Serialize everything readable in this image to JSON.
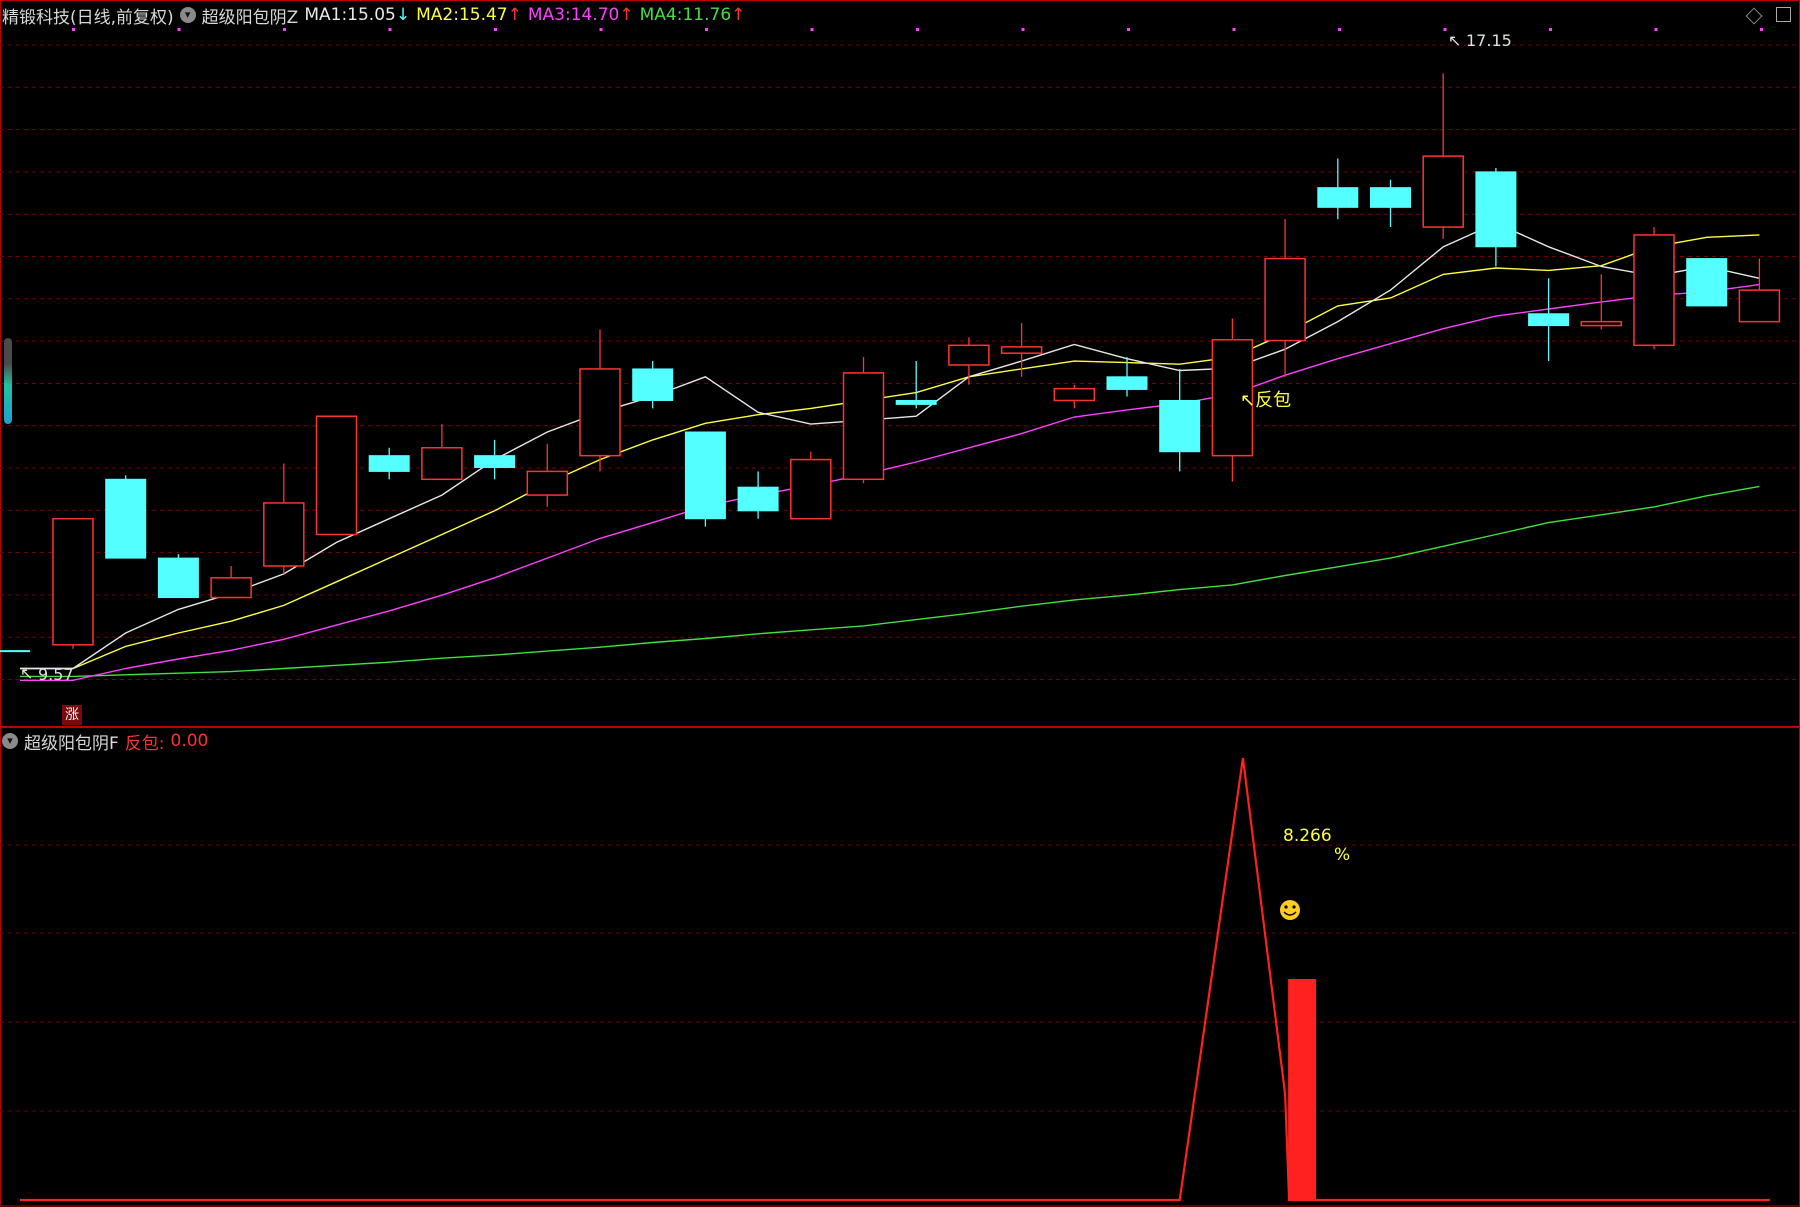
{
  "header": {
    "stock_title": "精锻科技(日线,前复权)",
    "indicator_name": "超级阳包阴Z",
    "ma1_label": "MA1:",
    "ma1_value": "15.05",
    "ma1_arrow": "↓",
    "ma2_label": "MA2:",
    "ma2_value": "15.47",
    "ma2_arrow": "↑",
    "ma3_label": "MA3:",
    "ma3_value": "14.70",
    "ma3_arrow": "↑",
    "ma4_label": "MA4:",
    "ma4_value": "11.76",
    "ma4_arrow": "↑"
  },
  "sub_header": {
    "indicator_name": "超级阳包阴F",
    "param_label": "反包:",
    "param_value": "0.00"
  },
  "annotations": {
    "high_label": "17.15",
    "low_label": "9.57",
    "fanbao_label": "↖反包",
    "zhang_badge": "涨",
    "pct_value": "8.266",
    "pct_sign": "%",
    "smiley": "☺"
  },
  "colors": {
    "background": "#000000",
    "up_candle": "#ff3232",
    "down_candle": "#54ffff",
    "ma1": "#e6e6e6",
    "ma2": "#ffff40",
    "ma3": "#ff40ff",
    "ma4": "#40e040",
    "grid": "#7a0000",
    "panel_border": "#c00000",
    "signal": "#ff2020"
  },
  "chart_data": {
    "type": "candlestick",
    "price_axis": {
      "low": 9.57,
      "high": 17.15
    },
    "candles": [
      {
        "o": 9.9,
        "h": 11.5,
        "l": 9.85,
        "c": 11.5
      },
      {
        "o": 12.0,
        "h": 12.05,
        "l": 11.0,
        "c": 11.0
      },
      {
        "o": 11.0,
        "h": 11.05,
        "l": 10.5,
        "c": 10.5
      },
      {
        "o": 10.5,
        "h": 10.9,
        "l": 10.5,
        "c": 10.75
      },
      {
        "o": 10.9,
        "h": 12.2,
        "l": 10.8,
        "c": 11.7
      },
      {
        "o": 11.3,
        "h": 12.6,
        "l": 11.3,
        "c": 12.8
      },
      {
        "o": 12.3,
        "h": 12.4,
        "l": 12.0,
        "c": 12.1
      },
      {
        "o": 12.0,
        "h": 12.7,
        "l": 12.0,
        "c": 12.4
      },
      {
        "o": 12.3,
        "h": 12.5,
        "l": 12.0,
        "c": 12.15
      },
      {
        "o": 11.8,
        "h": 12.45,
        "l": 11.65,
        "c": 12.1
      },
      {
        "o": 12.3,
        "h": 13.9,
        "l": 12.1,
        "c": 13.4
      },
      {
        "o": 13.4,
        "h": 13.5,
        "l": 12.9,
        "c": 13.0
      },
      {
        "o": 12.6,
        "h": 12.6,
        "l": 11.4,
        "c": 11.5
      },
      {
        "o": 11.9,
        "h": 12.1,
        "l": 11.5,
        "c": 11.6
      },
      {
        "o": 11.5,
        "h": 12.35,
        "l": 11.5,
        "c": 12.25
      },
      {
        "o": 12.0,
        "h": 13.55,
        "l": 11.95,
        "c": 13.35
      },
      {
        "o": 13.0,
        "h": 13.5,
        "l": 12.9,
        "c": 12.95
      },
      {
        "o": 13.45,
        "h": 13.8,
        "l": 13.2,
        "c": 13.7
      },
      {
        "o": 13.6,
        "h": 13.98,
        "l": 13.3,
        "c": 13.68
      },
      {
        "o": 13.0,
        "h": 13.2,
        "l": 12.9,
        "c": 13.15
      },
      {
        "o": 13.3,
        "h": 13.55,
        "l": 13.05,
        "c": 13.14
      },
      {
        "o": 13.0,
        "h": 13.4,
        "l": 12.1,
        "c": 12.35
      },
      {
        "o": 12.3,
        "h": 14.04,
        "l": 11.97,
        "c": 13.77
      },
      {
        "o": 13.76,
        "h": 15.3,
        "l": 13.3,
        "c": 14.8
      },
      {
        "o": 15.7,
        "h": 16.07,
        "l": 15.3,
        "c": 15.45
      },
      {
        "o": 15.7,
        "h": 15.8,
        "l": 15.2,
        "c": 15.45
      },
      {
        "o": 15.2,
        "h": 17.15,
        "l": 15.05,
        "c": 16.1
      },
      {
        "o": 15.9,
        "h": 15.95,
        "l": 14.7,
        "c": 14.95
      },
      {
        "o": 14.1,
        "h": 14.55,
        "l": 13.5,
        "c": 13.95
      },
      {
        "o": 13.95,
        "h": 14.6,
        "l": 13.9,
        "c": 14.0
      },
      {
        "o": 13.7,
        "h": 15.2,
        "l": 13.65,
        "c": 15.1
      },
      {
        "o": 14.8,
        "h": 14.8,
        "l": 14.2,
        "c": 14.2
      },
      {
        "o": 14.0,
        "h": 14.8,
        "l": 14.0,
        "c": 14.4
      }
    ],
    "ma1": [
      9.6,
      10.05,
      10.35,
      10.55,
      10.8,
      11.2,
      11.5,
      11.8,
      12.25,
      12.6,
      12.85,
      13.05,
      13.3,
      12.85,
      12.7,
      12.75,
      12.8,
      13.3,
      13.5,
      13.71,
      13.53,
      13.38,
      13.41,
      13.65,
      14.0,
      14.4,
      14.95,
      15.25,
      14.95,
      14.7,
      14.58,
      14.7,
      14.55
    ],
    "ma2": [
      9.6,
      9.88,
      10.05,
      10.2,
      10.4,
      10.7,
      11.0,
      11.3,
      11.6,
      11.95,
      12.25,
      12.5,
      12.71,
      12.82,
      12.9,
      13.0,
      13.1,
      13.3,
      13.4,
      13.5,
      13.48,
      13.46,
      13.55,
      13.85,
      14.2,
      14.3,
      14.6,
      14.68,
      14.65,
      14.71,
      14.95,
      15.07,
      15.1
    ],
    "ma3": [
      9.45,
      9.6,
      9.72,
      9.83,
      9.97,
      10.15,
      10.33,
      10.53,
      10.75,
      11.0,
      11.25,
      11.45,
      11.66,
      11.8,
      11.92,
      12.06,
      12.22,
      12.4,
      12.58,
      12.79,
      12.88,
      12.96,
      13.08,
      13.32,
      13.53,
      13.72,
      13.91,
      14.07,
      14.16,
      14.25,
      14.33,
      14.38,
      14.47
    ],
    "ma4": [
      9.5,
      9.52,
      9.54,
      9.56,
      9.6,
      9.64,
      9.68,
      9.73,
      9.77,
      9.82,
      9.87,
      9.93,
      9.98,
      10.04,
      10.09,
      10.14,
      10.22,
      10.3,
      10.39,
      10.47,
      10.53,
      10.6,
      10.66,
      10.78,
      10.89,
      11.0,
      11.15,
      11.3,
      11.45,
      11.55,
      11.65,
      11.79,
      11.91
    ],
    "sub_axis": {
      "low": 0,
      "high": 10
    },
    "signal_line": [
      0,
      0,
      0,
      0,
      0,
      0,
      0,
      0,
      0,
      0,
      0,
      0,
      0,
      0,
      0,
      0,
      0,
      0,
      0,
      0,
      0,
      0,
      0,
      0,
      0,
      0,
      0,
      0,
      0,
      0,
      0,
      0,
      0
    ],
    "signal_peaks": [
      {
        "index": 22.2,
        "value": 10.0
      },
      {
        "index": 23.0,
        "value": 2.4
      },
      {
        "index": 23.0,
        "value": 0
      }
    ],
    "signal_bar": {
      "index": 23,
      "value": 5.0
    }
  }
}
